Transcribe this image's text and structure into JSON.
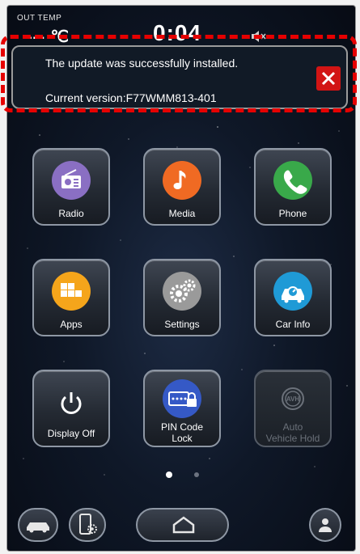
{
  "status": {
    "out_temp_label": "OUT TEMP",
    "out_temp_value": "--- ℃",
    "clock": "0:04",
    "mute_icon": "speaker-muted-icon"
  },
  "banner": {
    "message": "The update was successfully installed.",
    "version": "Current version:F77WMM813-401",
    "close_icon": "close-icon"
  },
  "tiles": [
    {
      "label": "Radio",
      "icon": "radio-icon",
      "color": "#8a6fc3"
    },
    {
      "label": "Media",
      "icon": "music-note-icon",
      "color": "#f06a23"
    },
    {
      "label": "Phone",
      "icon": "phone-icon",
      "color": "#39a94a"
    },
    {
      "label": "Apps",
      "icon": "apps-grid-icon",
      "color": "#f5a51b"
    },
    {
      "label": "Settings",
      "icon": "gears-icon",
      "color": "#9a9a9a"
    },
    {
      "label": "Car Info",
      "icon": "car-info-icon",
      "color": "#1f9ad6"
    },
    {
      "label": "Display Off",
      "icon": "power-icon",
      "color": "transparent"
    },
    {
      "label": "PIN Code Lock",
      "label_line1": "PIN Code",
      "label_line2": "Lock",
      "icon": "pin-lock-icon",
      "color": "#3559c6"
    },
    {
      "label": "Auto Vehicle Hold",
      "label_line1": "Auto",
      "label_line2": "Vehicle Hold",
      "icon": "avh-icon",
      "color": "transparent",
      "enabled": false
    }
  ],
  "pager": {
    "pages": 2,
    "current": 1
  },
  "bottom_bar": {
    "car_icon": "car-icon",
    "phone_settings_icon": "phone-settings-icon",
    "home_icon": "home-icon",
    "profile_icon": "person-icon"
  }
}
